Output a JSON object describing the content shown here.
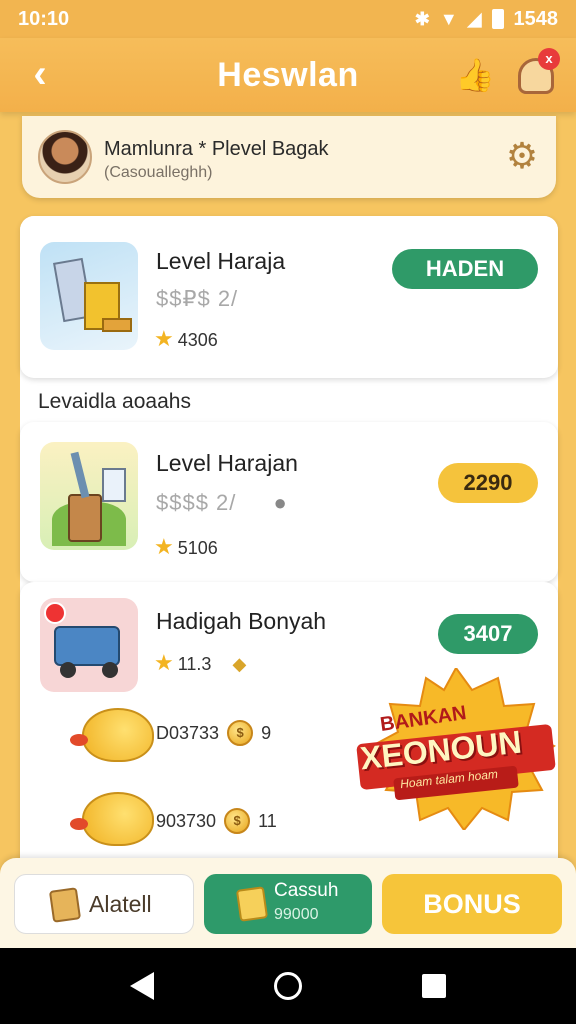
{
  "status_bar": {
    "time": "10:10",
    "clock_right": "1548",
    "icons": [
      "bluetooth-icon",
      "wifi-icon",
      "signal-icon",
      "battery-icon"
    ]
  },
  "header": {
    "title": "Heswlan",
    "icons": [
      "back-arrow-icon",
      "thumbs-up-icon",
      "profile-icon"
    ],
    "notification_count": "x"
  },
  "user": {
    "name": "Mamlunra * Plevel Bagak",
    "subtitle": "(Casoualleghh)"
  },
  "items": [
    {
      "title": "Level Haraja",
      "price": "$$₽$ 2/",
      "rating": "4306",
      "action": "HADEN"
    },
    {
      "title": "Level Harajan",
      "price": "$$$$ 2/",
      "rating": "5106",
      "action": "2290"
    },
    {
      "title": "Hadigah Bonyah",
      "rating": "11.3",
      "action": "3407"
    }
  ],
  "section_label": "Levaidla aoaahs",
  "savings": [
    {
      "amount": "D03733",
      "coins": "9"
    },
    {
      "amount": "903730",
      "coins": "11"
    }
  ],
  "badge": {
    "top": "BANKAN",
    "main": "XEONOUN",
    "sub": "Hoam talam hoam"
  },
  "bottom_tabs": {
    "abot_label": "Alatell",
    "cash_label": "Cassuh",
    "cash_sub": "99000",
    "bonus_label": "BONUS"
  },
  "colors": {
    "primary": "#f6c560",
    "green": "#2f9a68",
    "yellow": "#f5c33c"
  }
}
